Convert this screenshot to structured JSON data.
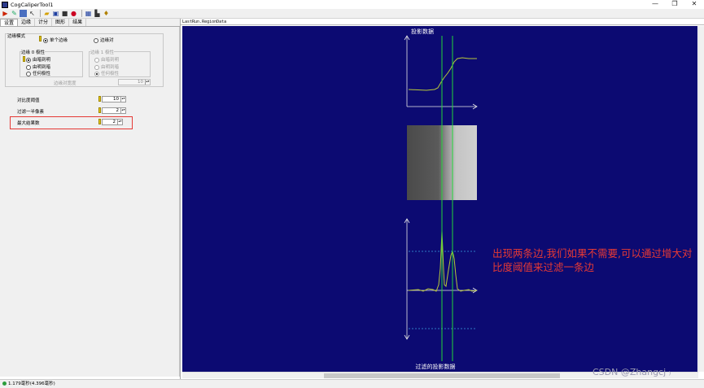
{
  "window": {
    "title": "CogCaliperTool1",
    "min_label": "—",
    "max_label": "❐",
    "close_label": "✕"
  },
  "toolbar": {
    "icons": [
      "run-icon",
      "edit-icon",
      "image-icon",
      "pointer-icon",
      "open-icon",
      "save-icon",
      "stop-icon",
      "record-icon",
      "grid-icon",
      "chart-icon",
      "help-icon"
    ]
  },
  "tabs": [
    "设置",
    "边缘",
    "计分",
    "图形",
    "结果"
  ],
  "settings": {
    "edge_mode_label": "边缘模式",
    "single_edge": "单个边缘",
    "edge_pair": "边缘对",
    "edge0_group": "边缘 0 极性",
    "edge1_group": "边缘 1 极性",
    "polarity_options": [
      "由暗到明",
      "由明到暗",
      "任何极性"
    ],
    "edge_pair_width_label": "边缘对宽度",
    "edge_pair_width_value": "10",
    "contrast_label": "对比度阈值",
    "contrast_value": "10",
    "filter_half_label": "过滤一半像素",
    "filter_half_value": "2",
    "max_results_label": "最大结果数",
    "max_results_value": "2"
  },
  "viewer": {
    "header": "LastRun.RegionData",
    "top_plot_label": "投影数据",
    "bottom_plot_label": "过滤的投影数据"
  },
  "annotation": {
    "text_line1": "出现两条边,我们如果不需要,可以通过增大对",
    "text_line2": "比度阈值来过滤一条边"
  },
  "watermark": "CSDN @Zhangcj ₎",
  "status": {
    "text": "1.179毫秒(4.396毫秒)"
  },
  "colors": {
    "canvas_bg": "#0c0a72",
    "axis": "#e8e8e8",
    "curve": "#b8c83a",
    "marker": "#22d63a",
    "threshold": "#3aa0e0",
    "annotation": "#e53935"
  }
}
